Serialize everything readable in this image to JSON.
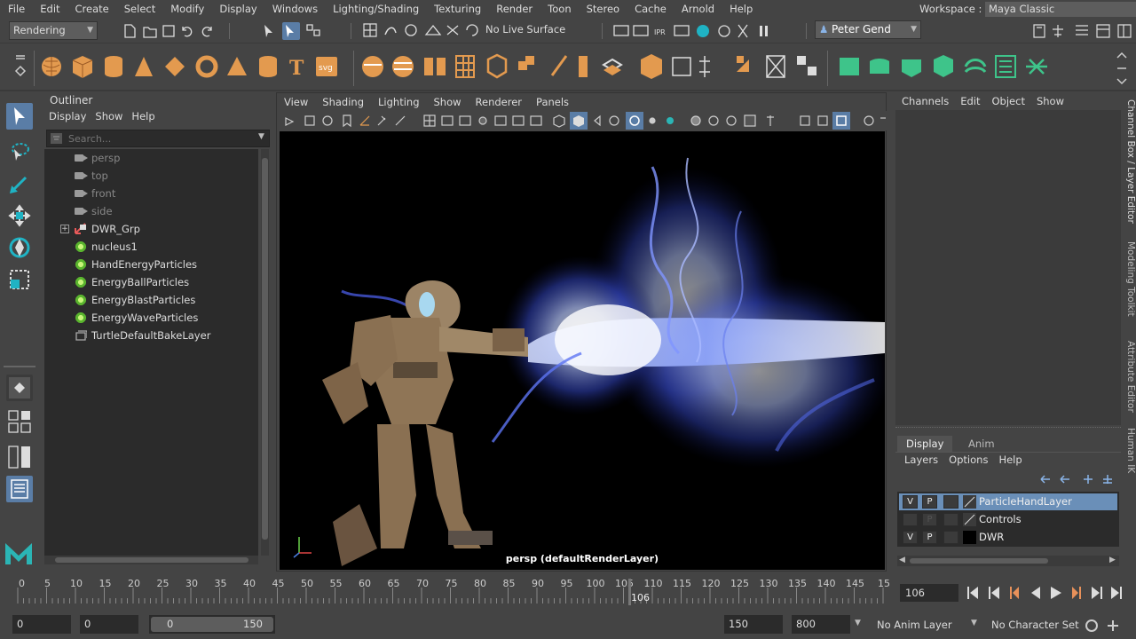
{
  "menubar": {
    "items": [
      "File",
      "Edit",
      "Create",
      "Select",
      "Modify",
      "Display",
      "Windows",
      "Lighting/Shading",
      "Texturing",
      "Render",
      "Toon",
      "Stereo",
      "Cache",
      "Arnold",
      "Help"
    ],
    "workspace_label": "Workspace :",
    "workspace_value": "Maya Classic"
  },
  "statusline": {
    "menu_set": "Rendering",
    "live_surface": "No Live Surface",
    "user": "Peter Gend"
  },
  "outliner": {
    "title": "Outliner",
    "menus": [
      "Display",
      "Show",
      "Help"
    ],
    "search_placeholder": "Search...",
    "items": [
      {
        "name": "persp",
        "icon": "camera-icon",
        "dim": true
      },
      {
        "name": "top",
        "icon": "camera-icon",
        "dim": true
      },
      {
        "name": "front",
        "icon": "camera-icon",
        "dim": true
      },
      {
        "name": "side",
        "icon": "camera-icon",
        "dim": true
      },
      {
        "name": "DWR_Grp",
        "icon": "group-icon",
        "dim": false,
        "expandable": true
      },
      {
        "name": "nucleus1",
        "icon": "nucleus-icon",
        "dim": false
      },
      {
        "name": "HandEnergyParticles",
        "icon": "particle-icon",
        "dim": false
      },
      {
        "name": "EnergyBallParticles",
        "icon": "particle-icon",
        "dim": false
      },
      {
        "name": "EnergyBlastParticles",
        "icon": "particle-icon",
        "dim": false
      },
      {
        "name": "EnergyWaveParticles",
        "icon": "particle-icon",
        "dim": false
      },
      {
        "name": "TurtleDefaultBakeLayer",
        "icon": "bake-layer-icon",
        "dim": false
      }
    ]
  },
  "viewport": {
    "menus": [
      "View",
      "Shading",
      "Lighting",
      "Show",
      "Renderer",
      "Panels"
    ],
    "camera_label": "persp (defaultRenderLayer)"
  },
  "channelbox": {
    "menus": [
      "Channels",
      "Edit",
      "Object",
      "Show"
    ]
  },
  "layer_editor": {
    "tabs": [
      "Display",
      "Anim"
    ],
    "menus": [
      "Layers",
      "Options",
      "Help"
    ],
    "layers": [
      {
        "v": "V",
        "p": "P",
        "name": "ParticleHandLayer",
        "selected": true,
        "color": "#3b3b3b"
      },
      {
        "v": "",
        "p": "P",
        "name": "Controls",
        "selected": false,
        "color": "#3b3b3b"
      },
      {
        "v": "V",
        "p": "P",
        "name": "DWR",
        "selected": false,
        "color": "#000000"
      }
    ]
  },
  "side_tabs": [
    "Channel Box / Layer Editor",
    "Modeling Toolkit",
    "Attribute Editor",
    "Human IK"
  ],
  "timeline": {
    "ticks": [
      "0",
      "5",
      "10",
      "15",
      "20",
      "25",
      "30",
      "35",
      "40",
      "45",
      "50",
      "55",
      "60",
      "65",
      "70",
      "75",
      "80",
      "85",
      "90",
      "95",
      "100",
      "105",
      "110",
      "115",
      "120",
      "125",
      "130",
      "135",
      "140",
      "145",
      "15"
    ],
    "current_frame": "106",
    "current_field": "106"
  },
  "range": {
    "start": "0",
    "anim_start": "0",
    "slider_start": "0",
    "slider_end": "150",
    "anim_end": "150",
    "end": "800",
    "anim_layer": "No Anim Layer",
    "character_set": "No Character Set"
  },
  "colors": {
    "accent": "#5a9bd5",
    "selected_layer": "#6a8fb8",
    "maya_logo": "#2bb5b5",
    "shelf_orange": "#e39a4f",
    "shelf_green": "#3ec48a"
  }
}
